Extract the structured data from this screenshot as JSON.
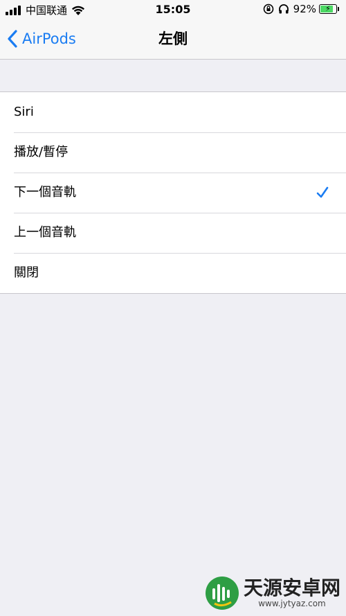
{
  "status_bar": {
    "carrier": "中国联通",
    "time": "15:05",
    "battery_percent": "92%",
    "battery_level": 0.92,
    "icons": [
      "signal-icon",
      "wifi-icon",
      "orientation-lock-icon",
      "headphones-icon",
      "battery-icon"
    ]
  },
  "nav": {
    "back_label": "AirPods",
    "title": "左側"
  },
  "options": [
    {
      "label": "Siri",
      "selected": false
    },
    {
      "label": "播放/暫停",
      "selected": false
    },
    {
      "label": "下一個音軌",
      "selected": true
    },
    {
      "label": "上一個音軌",
      "selected": false
    },
    {
      "label": "關閉",
      "selected": false
    }
  ],
  "watermark": {
    "name": "天源安卓网",
    "url": "www.jytyaz.com"
  },
  "colors": {
    "accent": "#1a7cf2",
    "background": "#efeff4",
    "battery": "#4cd964"
  }
}
